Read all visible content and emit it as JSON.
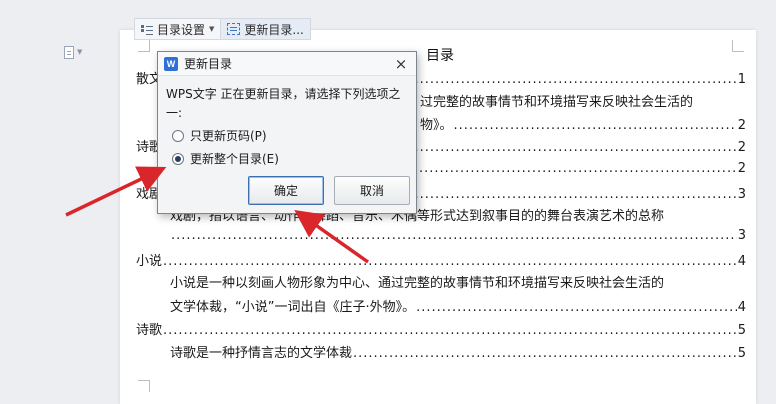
{
  "toolbar": {
    "toc_settings_label": "目录设置",
    "update_toc_label": "更新目录..."
  },
  "document": {
    "toc_title": "目录",
    "lines": [
      {
        "text": "散文",
        "page": "1"
      },
      {
        "text": "过完整的故事情节和环境描写来反映社会生活的",
        "page": ""
      },
      {
        "text": "物》。",
        "page": "2"
      },
      {
        "text": "诗歌",
        "page": "2"
      },
      {
        "text": "",
        "page": "2"
      },
      {
        "text": "戏剧",
        "page": "3"
      },
      {
        "text": "戏剧，指以语言、动作、舞蹈、音乐、木偶等形式达到叙事目的的舞台表演艺术的总称",
        "page": ""
      },
      {
        "text": "",
        "page": "3"
      },
      {
        "text": "小说",
        "page": "4"
      },
      {
        "text": "小说是一种以刻画人物形象为中心、通过完整的故事情节和环境描写来反映社会生活的",
        "page": ""
      },
      {
        "text": "文学体裁，“小说”一词出自《庄子·外物》。",
        "page": "4"
      },
      {
        "text": "诗歌",
        "page": "5"
      },
      {
        "text": "诗歌是一种抒情言志的文学体裁",
        "page": "5"
      }
    ]
  },
  "dialog": {
    "title": "更新目录",
    "message": "WPS文字 正在更新目录，请选择下列选项之一:",
    "option_page_numbers": "只更新页码(P)",
    "option_entire_toc": "更新整个目录(E)",
    "selected_option": "entire",
    "ok_label": "确定",
    "cancel_label": "取消",
    "close_glyph": "×"
  },
  "annotation_color": "#d9262b"
}
